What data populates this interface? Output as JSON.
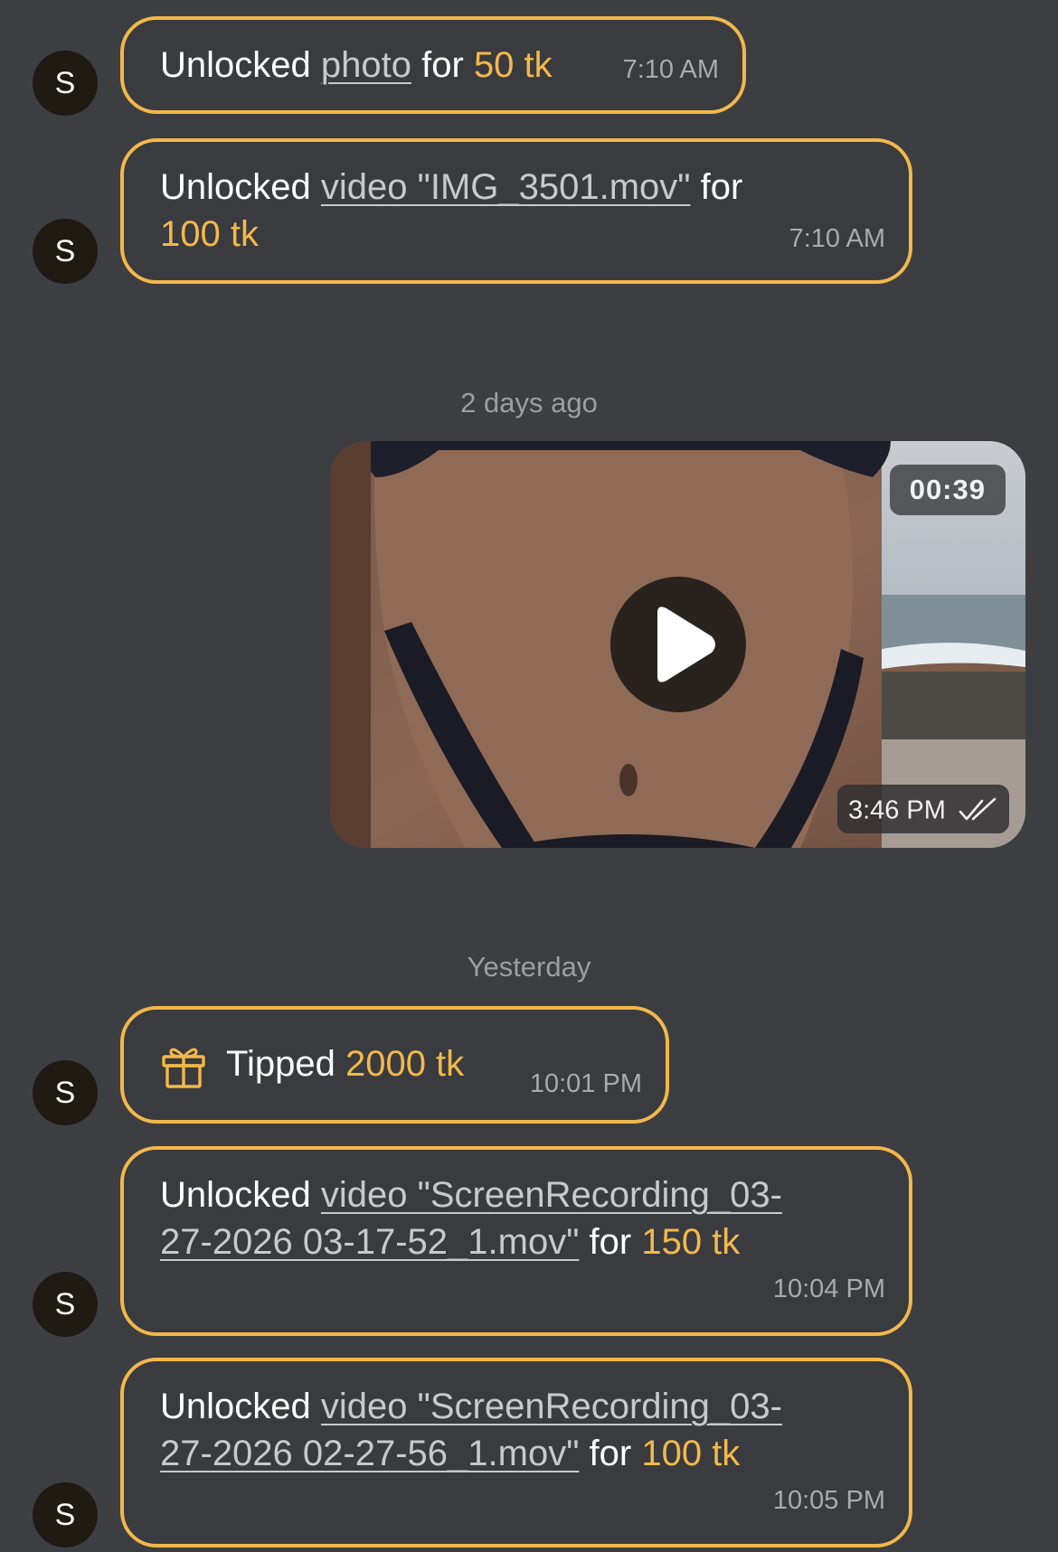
{
  "messages": {
    "m1": {
      "avatar": "S",
      "prefix": "Unlocked",
      "link": "photo",
      "for": "for",
      "amount": "50 tk",
      "time": "7:10 AM"
    },
    "m2": {
      "avatar": "S",
      "prefix": "Unlocked",
      "link": "video \"IMG_3501.mov\"",
      "for": "for",
      "amount": "100 tk",
      "time": "7:10 AM"
    },
    "m3": {
      "avatar": "S",
      "icon": "gift-icon",
      "prefix": "Tipped",
      "amount": "2000 tk",
      "time": "10:01 PM"
    },
    "m4": {
      "avatar": "S",
      "prefix": "Unlocked",
      "link_line1": "video \"ScreenRecording_03-",
      "link_line2": "27-2026 03-17-52_1.mov\"",
      "for": "for",
      "amount": "150 tk",
      "time": "10:04 PM"
    },
    "m5": {
      "avatar": "S",
      "prefix": "Unlocked",
      "link_line1": "video \"ScreenRecording_03-",
      "link_line2": "27-2026 02-27-56_1.mov\"",
      "for": "for",
      "amount": "100 tk",
      "time": "10:05 PM"
    }
  },
  "separators": {
    "s1": "2 days ago",
    "s2": "Yesterday"
  },
  "media": {
    "duration": "00:39",
    "time": "3:46 PM",
    "status_icon": "double-check-icon",
    "play_icon": "play-icon"
  },
  "colors": {
    "background": "#3d3e42",
    "accent": "#f2b84b",
    "avatar_bg": "#1f1a12",
    "timestamp": "#a9aaad"
  }
}
